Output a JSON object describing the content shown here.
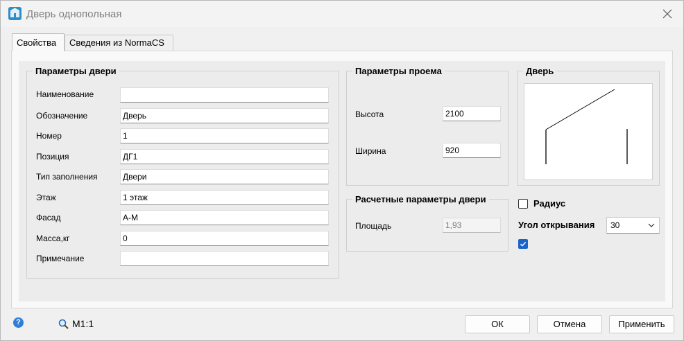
{
  "window": {
    "title": "Дверь однопольная",
    "icon": "door-app-icon"
  },
  "tabs": [
    {
      "label": "Свойства",
      "active": true
    },
    {
      "label": "Сведения из NormaCS",
      "active": false
    }
  ],
  "door_params": {
    "legend": "Параметры двери",
    "fields": [
      {
        "label": "Наименование",
        "value": ""
      },
      {
        "label": "Обозначение",
        "value": "Дверь"
      },
      {
        "label": "Номер",
        "value": "1"
      },
      {
        "label": "Позиция",
        "value": "ДГ1"
      },
      {
        "label": "Тип заполнения",
        "value": "Двери"
      },
      {
        "label": "Этаж",
        "value": "1 этаж"
      },
      {
        "label": "Фасад",
        "value": "А-М"
      },
      {
        "label": "Масса,кг",
        "value": "0"
      },
      {
        "label": "Примечание",
        "value": ""
      }
    ]
  },
  "opening_params": {
    "legend": "Параметры проема",
    "height_label": "Высота",
    "height_value": "2100",
    "width_label": "Ширина",
    "width_value": "920"
  },
  "calc_params": {
    "legend": "Расчетные параметры двери",
    "area_label": "Площадь",
    "area_value": "1,93"
  },
  "door_preview": {
    "legend": "Дверь"
  },
  "radius": {
    "label": "Радиус",
    "checked": false
  },
  "opening_angle": {
    "label": "Угол открывания",
    "value": "30"
  },
  "extra_checkbox": {
    "checked": true
  },
  "footer": {
    "help_icon": "?",
    "zoom_label": "М1:1",
    "ok_label": "ОК",
    "cancel_label": "Отмена",
    "apply_label": "Применить"
  },
  "colors": {
    "accent": "#1a64c8",
    "window_bg": "#f0f0f0",
    "panel_bg": "#ececec"
  }
}
